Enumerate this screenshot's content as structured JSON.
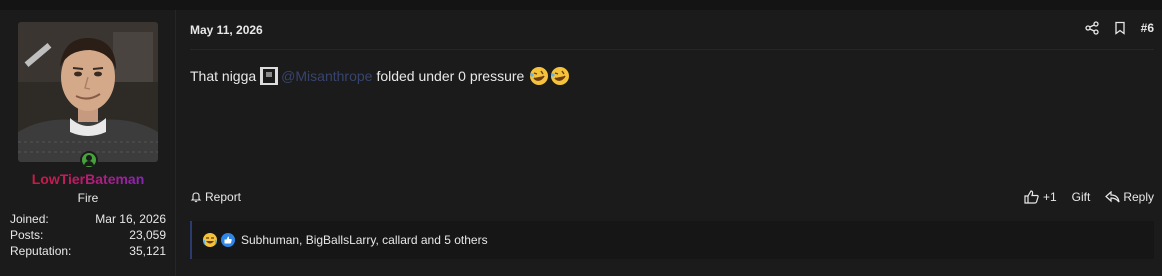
{
  "post": {
    "user": {
      "name": "LowTierBateman",
      "title": "Fire",
      "stats": [
        {
          "label": "Joined:",
          "value": "Mar 16, 2026"
        },
        {
          "label": "Posts:",
          "value": "23,059"
        },
        {
          "label": "Reputation:",
          "value": "35,121"
        }
      ]
    },
    "date": "May 11, 2026",
    "number": "#6",
    "message": {
      "before": "That nigga",
      "mention": "@Misanthrope",
      "after": "folded under 0 pressure"
    },
    "footer": {
      "report": "Report",
      "upvote": "+1",
      "gift": "Gift",
      "reply": "Reply"
    },
    "reactions": {
      "text": "Subhuman, BigBallsLarry, callard and 5 others"
    }
  },
  "colors": {
    "background": "#1b1b1b",
    "mention": "#37446e",
    "online": "#46a23a",
    "reaction_border": "#2d3a6e"
  },
  "icons": [
    "share-icon",
    "bookmark-icon",
    "bell-icon",
    "thumbs-up-icon",
    "reply-icon",
    "laughing-emoji-icon",
    "like-icon"
  ]
}
